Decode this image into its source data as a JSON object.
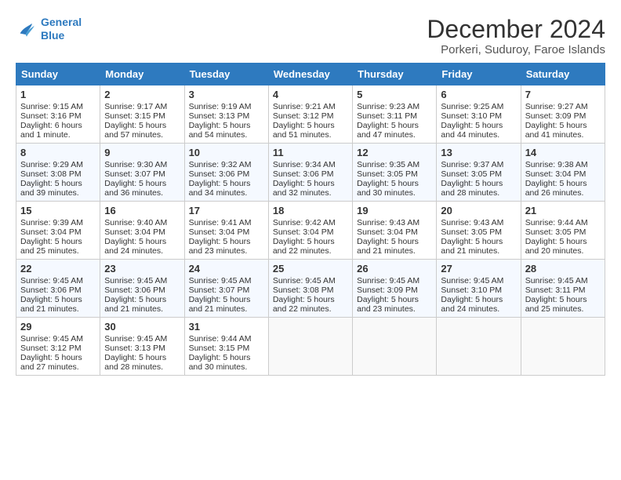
{
  "logo": {
    "line1": "General",
    "line2": "Blue"
  },
  "title": "December 2024",
  "subtitle": "Porkeri, Suduroy, Faroe Islands",
  "headers": [
    "Sunday",
    "Monday",
    "Tuesday",
    "Wednesday",
    "Thursday",
    "Friday",
    "Saturday"
  ],
  "weeks": [
    [
      {
        "day": "1",
        "sunrise": "Sunrise: 9:15 AM",
        "sunset": "Sunset: 3:16 PM",
        "daylight": "Daylight: 6 hours and 1 minute."
      },
      {
        "day": "2",
        "sunrise": "Sunrise: 9:17 AM",
        "sunset": "Sunset: 3:15 PM",
        "daylight": "Daylight: 5 hours and 57 minutes."
      },
      {
        "day": "3",
        "sunrise": "Sunrise: 9:19 AM",
        "sunset": "Sunset: 3:13 PM",
        "daylight": "Daylight: 5 hours and 54 minutes."
      },
      {
        "day": "4",
        "sunrise": "Sunrise: 9:21 AM",
        "sunset": "Sunset: 3:12 PM",
        "daylight": "Daylight: 5 hours and 51 minutes."
      },
      {
        "day": "5",
        "sunrise": "Sunrise: 9:23 AM",
        "sunset": "Sunset: 3:11 PM",
        "daylight": "Daylight: 5 hours and 47 minutes."
      },
      {
        "day": "6",
        "sunrise": "Sunrise: 9:25 AM",
        "sunset": "Sunset: 3:10 PM",
        "daylight": "Daylight: 5 hours and 44 minutes."
      },
      {
        "day": "7",
        "sunrise": "Sunrise: 9:27 AM",
        "sunset": "Sunset: 3:09 PM",
        "daylight": "Daylight: 5 hours and 41 minutes."
      }
    ],
    [
      {
        "day": "8",
        "sunrise": "Sunrise: 9:29 AM",
        "sunset": "Sunset: 3:08 PM",
        "daylight": "Daylight: 5 hours and 39 minutes."
      },
      {
        "day": "9",
        "sunrise": "Sunrise: 9:30 AM",
        "sunset": "Sunset: 3:07 PM",
        "daylight": "Daylight: 5 hours and 36 minutes."
      },
      {
        "day": "10",
        "sunrise": "Sunrise: 9:32 AM",
        "sunset": "Sunset: 3:06 PM",
        "daylight": "Daylight: 5 hours and 34 minutes."
      },
      {
        "day": "11",
        "sunrise": "Sunrise: 9:34 AM",
        "sunset": "Sunset: 3:06 PM",
        "daylight": "Daylight: 5 hours and 32 minutes."
      },
      {
        "day": "12",
        "sunrise": "Sunrise: 9:35 AM",
        "sunset": "Sunset: 3:05 PM",
        "daylight": "Daylight: 5 hours and 30 minutes."
      },
      {
        "day": "13",
        "sunrise": "Sunrise: 9:37 AM",
        "sunset": "Sunset: 3:05 PM",
        "daylight": "Daylight: 5 hours and 28 minutes."
      },
      {
        "day": "14",
        "sunrise": "Sunrise: 9:38 AM",
        "sunset": "Sunset: 3:04 PM",
        "daylight": "Daylight: 5 hours and 26 minutes."
      }
    ],
    [
      {
        "day": "15",
        "sunrise": "Sunrise: 9:39 AM",
        "sunset": "Sunset: 3:04 PM",
        "daylight": "Daylight: 5 hours and 25 minutes."
      },
      {
        "day": "16",
        "sunrise": "Sunrise: 9:40 AM",
        "sunset": "Sunset: 3:04 PM",
        "daylight": "Daylight: 5 hours and 24 minutes."
      },
      {
        "day": "17",
        "sunrise": "Sunrise: 9:41 AM",
        "sunset": "Sunset: 3:04 PM",
        "daylight": "Daylight: 5 hours and 23 minutes."
      },
      {
        "day": "18",
        "sunrise": "Sunrise: 9:42 AM",
        "sunset": "Sunset: 3:04 PM",
        "daylight": "Daylight: 5 hours and 22 minutes."
      },
      {
        "day": "19",
        "sunrise": "Sunrise: 9:43 AM",
        "sunset": "Sunset: 3:04 PM",
        "daylight": "Daylight: 5 hours and 21 minutes."
      },
      {
        "day": "20",
        "sunrise": "Sunrise: 9:43 AM",
        "sunset": "Sunset: 3:05 PM",
        "daylight": "Daylight: 5 hours and 21 minutes."
      },
      {
        "day": "21",
        "sunrise": "Sunrise: 9:44 AM",
        "sunset": "Sunset: 3:05 PM",
        "daylight": "Daylight: 5 hours and 20 minutes."
      }
    ],
    [
      {
        "day": "22",
        "sunrise": "Sunrise: 9:45 AM",
        "sunset": "Sunset: 3:06 PM",
        "daylight": "Daylight: 5 hours and 21 minutes."
      },
      {
        "day": "23",
        "sunrise": "Sunrise: 9:45 AM",
        "sunset": "Sunset: 3:06 PM",
        "daylight": "Daylight: 5 hours and 21 minutes."
      },
      {
        "day": "24",
        "sunrise": "Sunrise: 9:45 AM",
        "sunset": "Sunset: 3:07 PM",
        "daylight": "Daylight: 5 hours and 21 minutes."
      },
      {
        "day": "25",
        "sunrise": "Sunrise: 9:45 AM",
        "sunset": "Sunset: 3:08 PM",
        "daylight": "Daylight: 5 hours and 22 minutes."
      },
      {
        "day": "26",
        "sunrise": "Sunrise: 9:45 AM",
        "sunset": "Sunset: 3:09 PM",
        "daylight": "Daylight: 5 hours and 23 minutes."
      },
      {
        "day": "27",
        "sunrise": "Sunrise: 9:45 AM",
        "sunset": "Sunset: 3:10 PM",
        "daylight": "Daylight: 5 hours and 24 minutes."
      },
      {
        "day": "28",
        "sunrise": "Sunrise: 9:45 AM",
        "sunset": "Sunset: 3:11 PM",
        "daylight": "Daylight: 5 hours and 25 minutes."
      }
    ],
    [
      {
        "day": "29",
        "sunrise": "Sunrise: 9:45 AM",
        "sunset": "Sunset: 3:12 PM",
        "daylight": "Daylight: 5 hours and 27 minutes."
      },
      {
        "day": "30",
        "sunrise": "Sunrise: 9:45 AM",
        "sunset": "Sunset: 3:13 PM",
        "daylight": "Daylight: 5 hours and 28 minutes."
      },
      {
        "day": "31",
        "sunrise": "Sunrise: 9:44 AM",
        "sunset": "Sunset: 3:15 PM",
        "daylight": "Daylight: 5 hours and 30 minutes."
      },
      null,
      null,
      null,
      null
    ]
  ]
}
